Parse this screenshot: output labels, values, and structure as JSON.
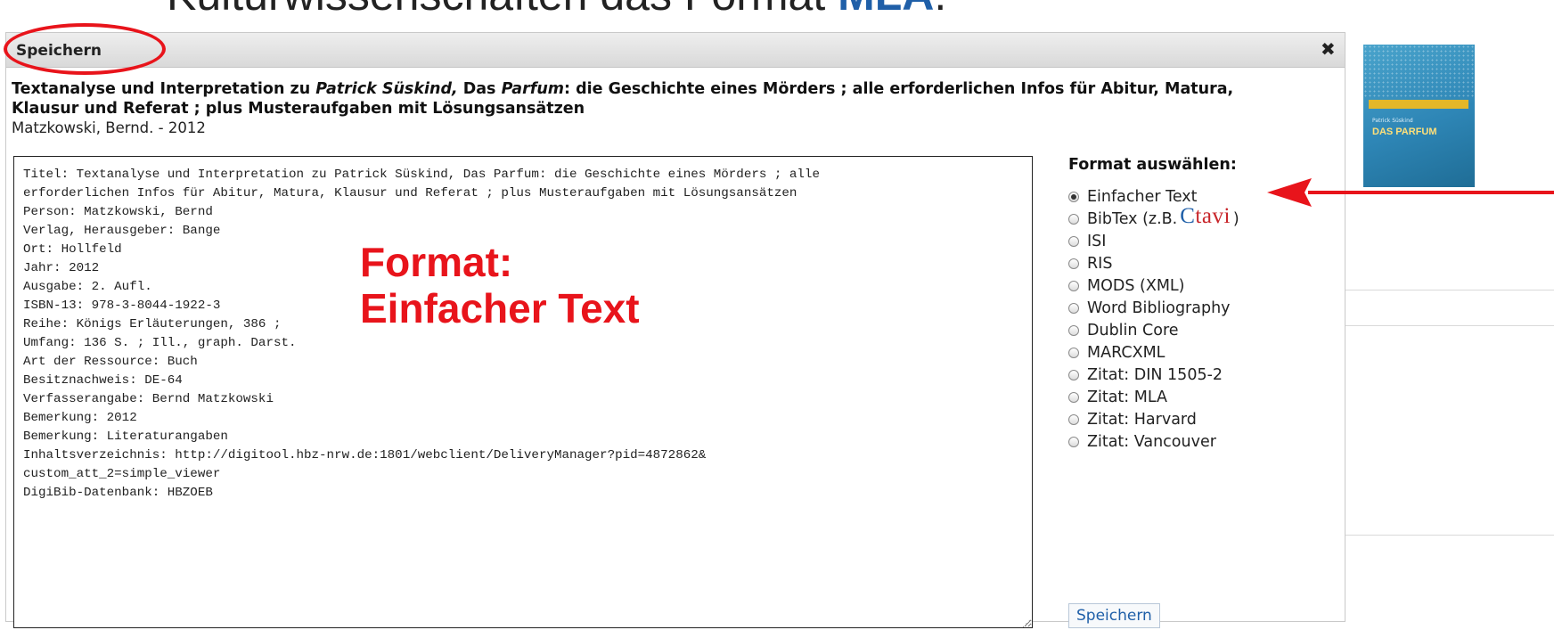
{
  "slide": {
    "heading_prefix": "Kulturwissenschaften das Format ",
    "heading_accent": "MLA",
    "heading_suffix": "."
  },
  "dialog": {
    "title": "Speichern",
    "close_icon": "close-icon",
    "book": {
      "title_part1": "Textanalyse und Interpretation zu ",
      "title_italic_author": "Patrick Süskind,",
      "title_part2": " Das ",
      "title_italic_work": "Parfum",
      "title_part3": ": die Geschichte eines Mörders ; alle erforderlichen Infos für Abitur, Matura, Klausur und Referat ; plus Musteraufgaben mit Lösungsansätzen",
      "author_line": "Matzkowski, Bernd. - 2012"
    },
    "record_text": "Titel: Textanalyse und Interpretation zu Patrick Süskind, Das Parfum: die Geschichte eines Mörders ; alle\nerforderlichen Infos für Abitur, Matura, Klausur und Referat ; plus Musteraufgaben mit Lösungsansätzen\nPerson: Matzkowski, Bernd\nVerlag, Herausgeber: Bange\nOrt: Hollfeld\nJahr: 2012\nAusgabe: 2. Aufl.\nISBN-13: 978-3-8044-1922-3\nReihe: Königs Erläuterungen, 386 ;\nUmfang: 136 S. ; Ill., graph. Darst.\nArt der Ressource: Buch\nBesitznachweis: DE-64\nVerfasserangabe: Bernd Matzkowski\nBemerkung: 2012\nBemerkung: Literaturangaben\nInhaltsverzeichnis: http://digitool.hbz-nrw.de:1801/webclient/DeliveryManager?pid=4872862&\ncustom_att_2=simple_viewer\nDigiBib-Datenbank: HBZOEB",
    "format_heading": "Format auswählen:",
    "formats": [
      {
        "label": "Einfacher Text",
        "checked": true
      },
      {
        "label": "BibTex (z.B. ",
        "logo": "citavi",
        "logo_prefix": "C",
        "logo_rest": "tavi",
        "suffix": ")",
        "checked": false
      },
      {
        "label": "ISI",
        "checked": false
      },
      {
        "label": "RIS",
        "checked": false
      },
      {
        "label": "MODS (XML)",
        "checked": false
      },
      {
        "label": "Word Bibliography",
        "checked": false
      },
      {
        "label": "Dublin Core",
        "checked": false
      },
      {
        "label": "MARCXML",
        "checked": false
      },
      {
        "label": "Zitat: DIN 1505-2",
        "checked": false
      },
      {
        "label": "Zitat: MLA",
        "checked": false
      },
      {
        "label": "Zitat: Harvard",
        "checked": false
      },
      {
        "label": "Zitat: Vancouver",
        "checked": false
      }
    ],
    "save_button": "Speichern"
  },
  "background_panel": {
    "cover_author": "Patrick Süskind",
    "cover_title": "DAS PARFUM"
  },
  "annotation": {
    "line1": "Format:",
    "line2": "Einfacher Text",
    "color": "#e8141b"
  }
}
